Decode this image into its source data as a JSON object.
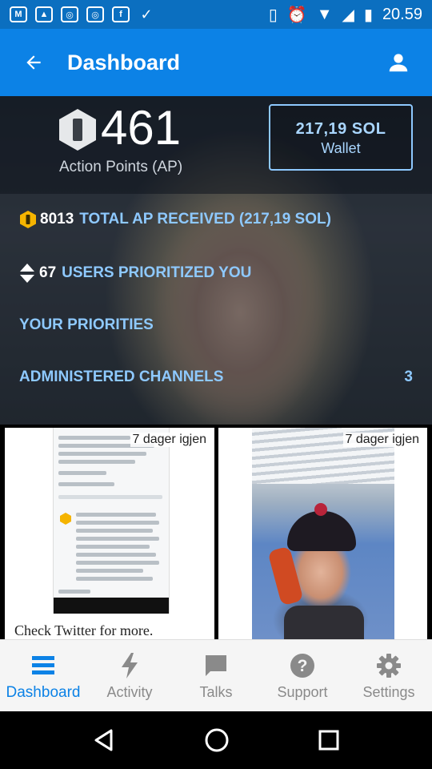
{
  "status_bar": {
    "time": "20.59",
    "left_icons": [
      "gmail-icon",
      "gallery-icon",
      "instagram-icon",
      "instagram-icon",
      "facebook-icon",
      "task-icon"
    ],
    "right_icons": [
      "vibrate-icon",
      "alarm-icon",
      "wifi-icon",
      "signal-icon",
      "battery-icon"
    ]
  },
  "app_bar": {
    "title": "Dashboard",
    "back_icon": "arrow-left-icon",
    "profile_icon": "person-icon"
  },
  "summary": {
    "action_points": "461",
    "action_points_label": "Action Points (AP)",
    "wallet_amount": "217,19 SOL",
    "wallet_label": "Wallet"
  },
  "stats": {
    "total_ap_value": "8013",
    "total_ap_label": "TOTAL AP RECEIVED (217,19 SOL)",
    "users_value": "67",
    "users_label": "USERS PRIORITIZED YOU",
    "your_priorities": "YOUR PRIORITIES",
    "administered_channels": "ADMINISTERED CHANNELS",
    "administered_count": "3"
  },
  "cards": [
    {
      "expiry": "7 dager igjen",
      "caption": "Check Twitter for more."
    },
    {
      "expiry": "7 dager igjen",
      "caption": ""
    }
  ],
  "bottom_nav": [
    {
      "label": "Dashboard",
      "icon": "dashboard-icon",
      "active": true
    },
    {
      "label": "Activity",
      "icon": "lightning-icon",
      "active": false
    },
    {
      "label": "Talks",
      "icon": "chat-icon",
      "active": false
    },
    {
      "label": "Support",
      "icon": "help-icon",
      "active": false
    },
    {
      "label": "Settings",
      "icon": "gear-icon",
      "active": false
    }
  ],
  "colors": {
    "app_bar": "#0c82e6",
    "status_bar": "#0b6fc0",
    "link": "#8ec9ff",
    "coin": "#f5b400",
    "nav_active": "#0c82e6",
    "nav_inactive": "#8a8a8a"
  }
}
